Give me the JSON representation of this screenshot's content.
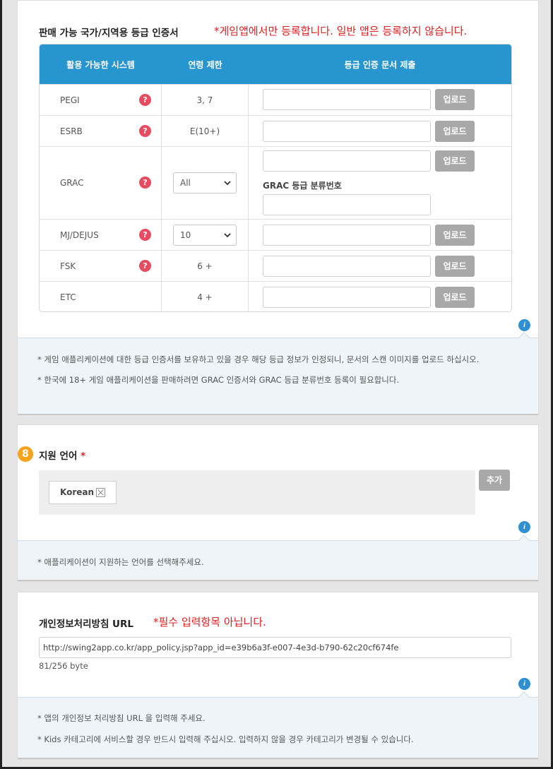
{
  "ratings": {
    "title": "판매 가능 국가/지역용 등급 인증서",
    "note": "*게임앱에서만 등록합니다. 일반 앱은 등록하지 않습니다.",
    "headers": [
      "활용 가능한 시스템",
      "연령 제한",
      "등급 인증 문서 제출"
    ],
    "rows": [
      {
        "system": "PEGI",
        "age": "3, 7",
        "upload": "업로드"
      },
      {
        "system": "ESRB",
        "age": "E(10+)",
        "upload": "업로드"
      },
      {
        "system": "GRAC",
        "age": "All",
        "upload": "업로드",
        "extra_label": "GRAC 등급 분류번호"
      },
      {
        "system": "MJ/DEJUS",
        "age": "10",
        "upload": "업로드"
      },
      {
        "system": "FSK",
        "age": "6 +",
        "upload": "업로드"
      },
      {
        "system": "ETC",
        "age": "4 +",
        "upload": "업로드"
      }
    ],
    "help_glyph": "?",
    "info": [
      "* 게임 애플리케이션에 대한 등급 인증서를 보유하고 있을 경우 해당 등급 정보가 인정되니, 문서의 스캔 이미지를 업로드 하십시오.",
      "* 한국에 18+ 게임 애플리케이션을 판매하려면 GRAC 인증서와 GRAC 등급 분류번호 등록이 필요합니다."
    ]
  },
  "language": {
    "step": "8",
    "title": "지원 언어",
    "required_mark": "*",
    "chips": [
      "Korean"
    ],
    "add_label": "추가",
    "info": [
      "* 애플리케이션이 지원하는 언어를 선택해주세요."
    ]
  },
  "privacy": {
    "title": "개인정보처리방침 URL",
    "note": "*필수 입력항목 아닙니다.",
    "url": "http://swing2app.co.kr/app_policy.jsp?app_id=e39b6a3f-e007-4e3d-b790-62c20cf674fe",
    "byte_count": "81/256 byte",
    "info": [
      "* 앱의 개인정보 처리방침 URL 을 입력해 주세요.",
      "* Kids 카테고리에 서비스할 경우 반드시 입력해 주십시오. 입력하지 않을 경우 카테고리가 변경될 수 있습니다."
    ]
  },
  "info_glyph": "i",
  "colors": {
    "header_blue": "#2896ce",
    "help_red": "#e84a5f",
    "note_red": "#e02020",
    "info_blue": "#2e8fd3",
    "step_orange": "#f7a21b"
  },
  "icons": [
    "help-icon",
    "info-icon",
    "chevron-down-icon",
    "remove-icon"
  ]
}
